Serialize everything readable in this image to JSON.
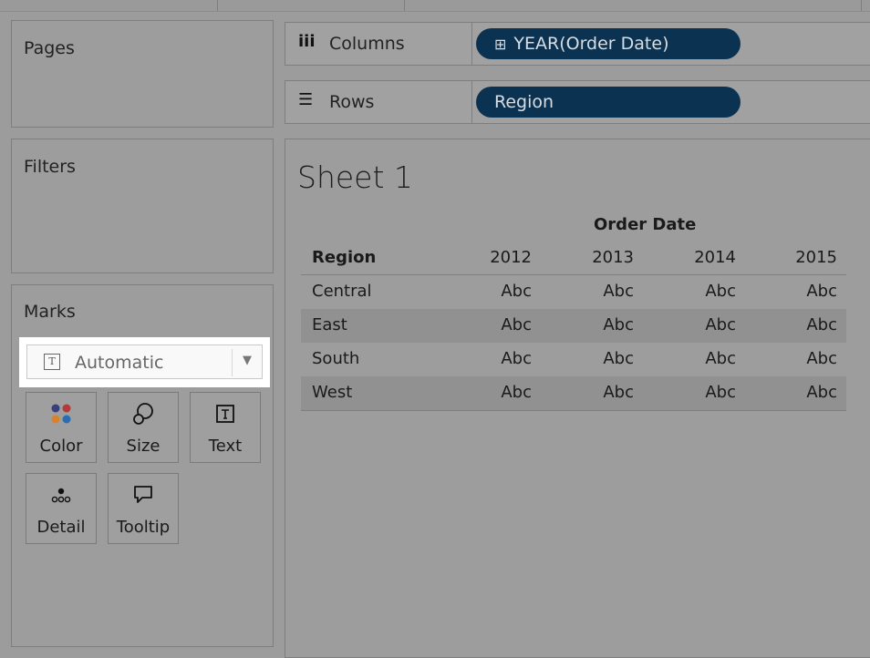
{
  "panels": {
    "pages": "Pages",
    "filters": "Filters",
    "marks": "Marks"
  },
  "shelves": {
    "columns": {
      "icon": "columns-icon",
      "label": "Columns",
      "pill_icon": "plus-box-icon",
      "pill": "YEAR(Order Date)"
    },
    "rows": {
      "icon": "rows-icon",
      "label": "Rows",
      "pill": "Region"
    }
  },
  "marks_card": {
    "mark_type": {
      "icon": "text-mark-icon",
      "label": "Automatic"
    },
    "buttons": [
      {
        "label": "Color",
        "icon": "color-dots-icon"
      },
      {
        "label": "Size",
        "icon": "size-icon"
      },
      {
        "label": "Text",
        "icon": "text-icon"
      },
      {
        "label": "Detail",
        "icon": "detail-dots-icon"
      },
      {
        "label": "Tooltip",
        "icon": "tooltip-icon"
      }
    ]
  },
  "sheet": {
    "title": "Sheet 1",
    "column_field": "Order Date",
    "row_header": "Region",
    "years": [
      "2012",
      "2013",
      "2014",
      "2015"
    ],
    "rows": [
      {
        "region": "Central",
        "cells": [
          "Abc",
          "Abc",
          "Abc",
          "Abc"
        ]
      },
      {
        "region": "East",
        "cells": [
          "Abc",
          "Abc",
          "Abc",
          "Abc"
        ]
      },
      {
        "region": "South",
        "cells": [
          "Abc",
          "Abc",
          "Abc",
          "Abc"
        ]
      },
      {
        "region": "West",
        "cells": [
          "Abc",
          "Abc",
          "Abc",
          "Abc"
        ]
      }
    ]
  },
  "colors": {
    "pill_bg": "#0b3250",
    "color_dots": [
      "#3b3f7a",
      "#b23a3a",
      "#d9822b",
      "#2a6db0"
    ]
  }
}
